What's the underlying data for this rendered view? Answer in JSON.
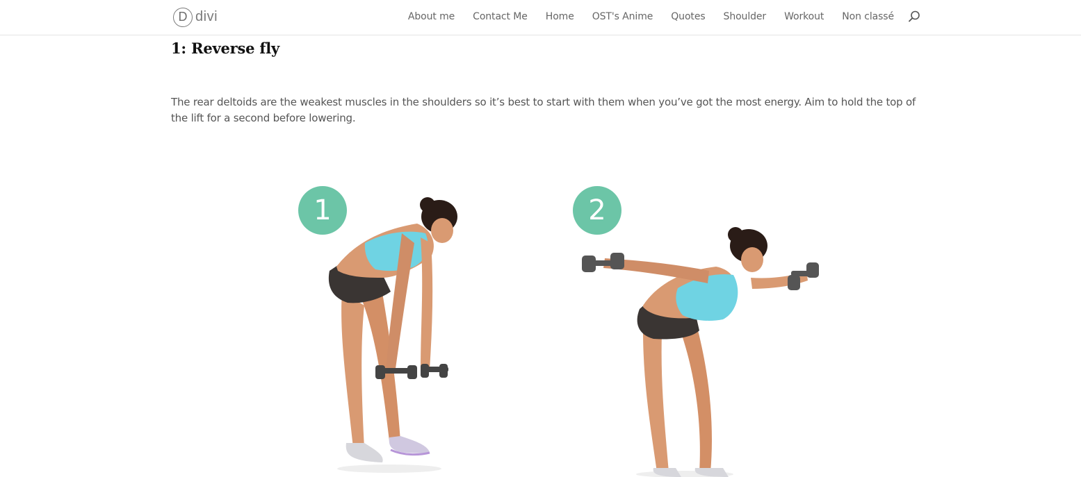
{
  "header": {
    "logo_letter": "D",
    "logo_text": "divi",
    "nav": [
      "About me",
      "Contact Me",
      "Home",
      "OST's Anime",
      "Quotes",
      "Shoulder",
      "Workout",
      "Non classé"
    ],
    "search_icon": "search-icon"
  },
  "article": {
    "heading": "1: Reverse fly",
    "paragraph": "The rear deltoids are the weakest muscles in the shoulders so it’s best to start with them when you’ve got the most energy. Aim to hold the top of the lift for a second before lowering.",
    "steps": [
      "1",
      "2"
    ]
  },
  "colors": {
    "badge": "#6cc5a7",
    "top": "#6fd3e3",
    "shorts": "#3a3533",
    "skin": "#d99a72",
    "hair": "#2a1c17"
  }
}
